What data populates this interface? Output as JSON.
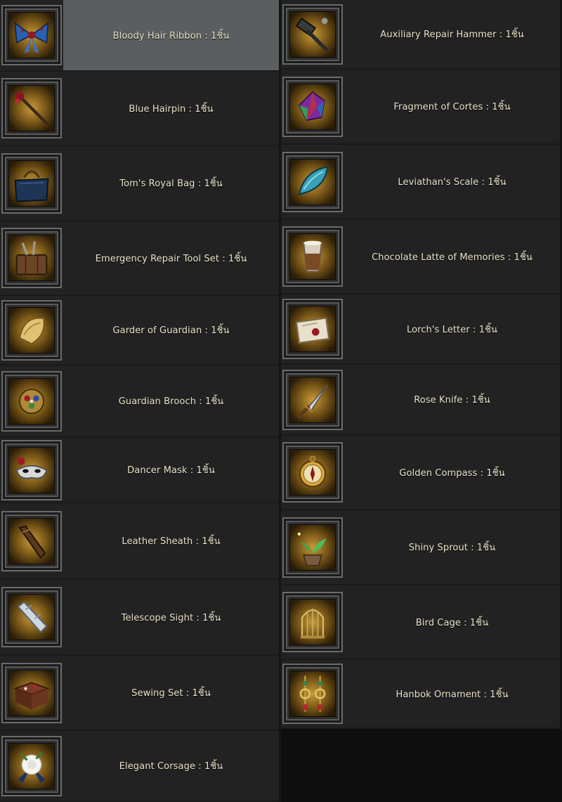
{
  "left_items": [
    {
      "label": "Bloody Hair Ribbon : 1ชิ้น",
      "icon": "ribbon-icon"
    },
    {
      "label": "Blue Hairpin : 1ชิ้น",
      "icon": "hairpin-icon"
    },
    {
      "label": "Tom's Royal Bag : 1ชิ้น",
      "icon": "bag-icon"
    },
    {
      "label": "Emergency Repair Tool Set : 1ชิ้น",
      "icon": "tool-set-icon"
    },
    {
      "label": "Garder of Guardian : 1ชิ้น",
      "icon": "garder-icon"
    },
    {
      "label": "Guardian Brooch : 1ชิ้น",
      "icon": "brooch-icon"
    },
    {
      "label": "Dancer Mask : 1ชิ้น",
      "icon": "mask-icon"
    },
    {
      "label": "Leather Sheath : 1ชิ้น",
      "icon": "sheath-icon"
    },
    {
      "label": "Telescope Sight : 1ชิ้น",
      "icon": "telescope-icon"
    },
    {
      "label": "Sewing Set : 1ชิ้น",
      "icon": "sewing-box-icon"
    },
    {
      "label": "Elegant Corsage : 1ชิ้น",
      "icon": "corsage-icon"
    }
  ],
  "right_items": [
    {
      "label": "Auxiliary Repair Hammer : 1ชิ้น",
      "icon": "hammer-icon"
    },
    {
      "label": "Fragment of Cortes : 1ชิ้น",
      "icon": "crystal-icon"
    },
    {
      "label": "Leviathan's Scale : 1ชิ้น",
      "icon": "scale-icon"
    },
    {
      "label": "Chocolate Latte of Memories : 1ชิ้น",
      "icon": "latte-icon"
    },
    {
      "label": "Lorch's Letter : 1ชิ้น",
      "icon": "letter-icon"
    },
    {
      "label": "Rose Knife : 1ชิ้น",
      "icon": "knife-icon"
    },
    {
      "label": "Golden Compass : 1ชิ้น",
      "icon": "compass-icon"
    },
    {
      "label": "Shiny Sprout : 1ชิ้น",
      "icon": "sprout-icon"
    },
    {
      "label": "Bird Cage : 1ชิ้น",
      "icon": "bird-cage-icon"
    },
    {
      "label": "Hanbok Ornament : 1ชิ้น",
      "icon": "ornament-icon"
    }
  ],
  "colors": {
    "row_background": "#222223",
    "highlight_background": "#5b5e60",
    "label_text": "#ece4c8",
    "icon_glow": "#c89a3a"
  }
}
